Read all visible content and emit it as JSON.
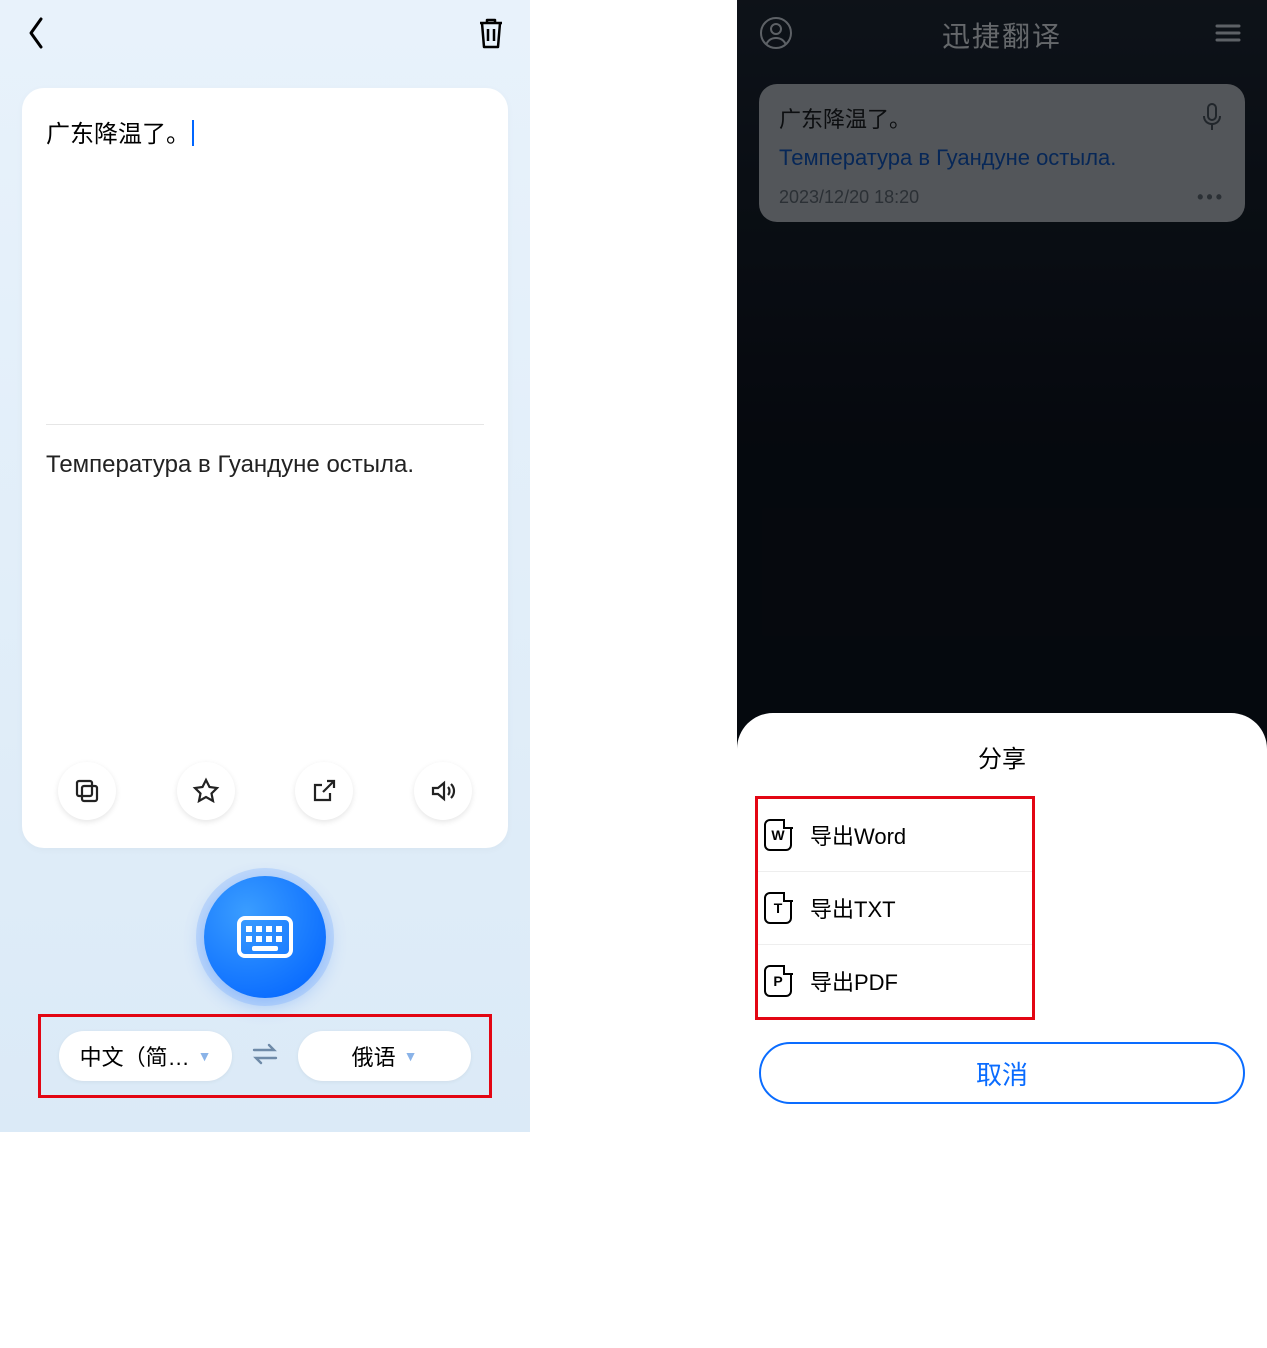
{
  "left": {
    "source_text": "广东降温了。",
    "target_text": "Температура в Гуандуне остыла.",
    "lang_from": "中文（简…",
    "lang_to": "俄语"
  },
  "right": {
    "title": "迅捷翻译",
    "card": {
      "source": "广东降温了。",
      "target": "Температура в Гуандуне остыла.",
      "timestamp": "2023/12/20 18:20"
    },
    "sheet": {
      "title": "分享",
      "items": [
        {
          "letter": "W",
          "label": "导出Word"
        },
        {
          "letter": "T",
          "label": "导出TXT"
        },
        {
          "letter": "P",
          "label": "导出PDF"
        }
      ],
      "cancel": "取消"
    }
  }
}
